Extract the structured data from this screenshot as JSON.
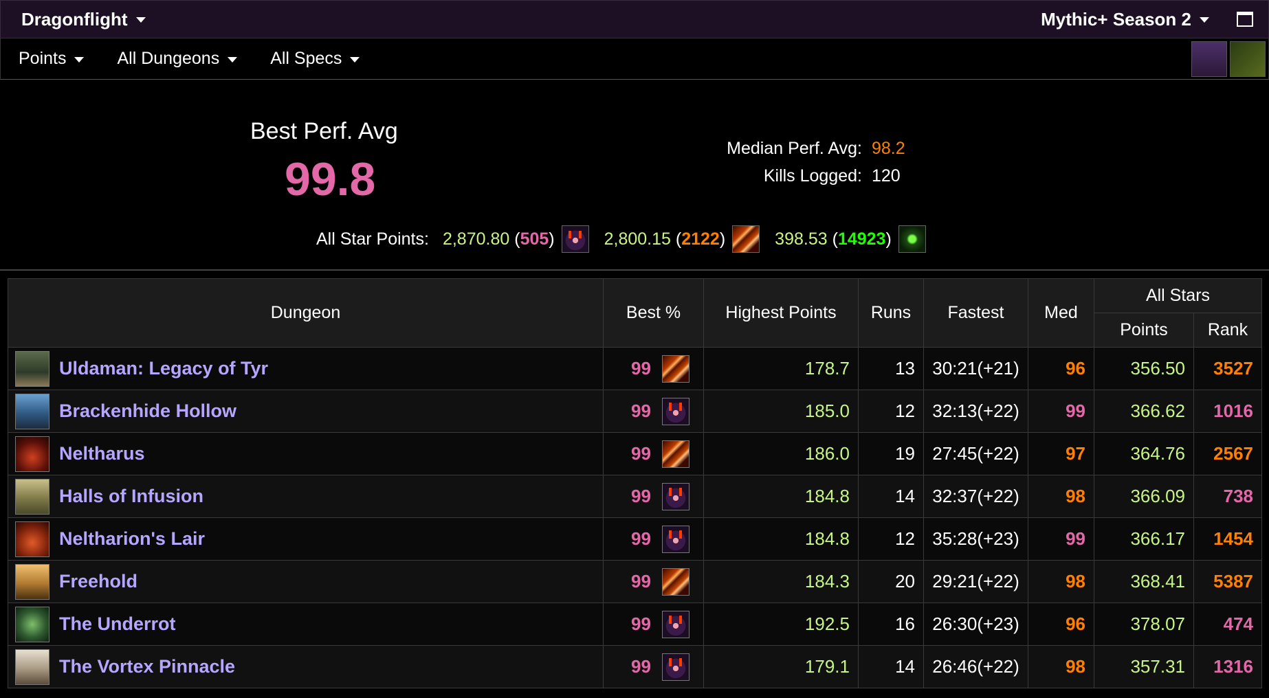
{
  "header": {
    "expansion": "Dragonflight",
    "season": "Mythic+ Season 2"
  },
  "filters": {
    "metric": "Points",
    "dungeons": "All Dungeons",
    "specs": "All Specs"
  },
  "summary": {
    "best_perf_label": "Best Perf. Avg",
    "best_perf_value": "99.8",
    "median_label": "Median Perf. Avg:",
    "median_value": "98.2",
    "kills_label": "Kills Logged:",
    "kills_value": "120",
    "allstar_label": "All Star Points:",
    "allstar": [
      {
        "points": "2,870.80",
        "rank": "505",
        "rank_color": "#e268a8",
        "icon": "demonic-spec-icon"
      },
      {
        "points": "2,800.15",
        "rank": "2122",
        "rank_color": "#ff8000",
        "icon": "fury-spec-icon"
      },
      {
        "points": "398.53",
        "rank": "14923",
        "rank_color": "#1eff00",
        "icon": "green-spec-icon"
      }
    ]
  },
  "table": {
    "headers": {
      "dungeon": "Dungeon",
      "best": "Best %",
      "highest": "Highest Points",
      "runs": "Runs",
      "fastest": "Fastest",
      "med": "Med",
      "allstars": "All Stars",
      "points": "Points",
      "rank": "Rank"
    },
    "rows": [
      {
        "name": "Uldaman: Legacy of Tyr",
        "best": "99",
        "spec": "fury",
        "highest": "178.7",
        "runs": "13",
        "fastest": "30:21(+21)",
        "med": "96",
        "med_color": "orange",
        "points": "356.50",
        "rank": "3527",
        "rank_color": "orange",
        "icon_bg": "linear-gradient(180deg,#5b6a4a,#2e3a28 60%,#8a7a5a)"
      },
      {
        "name": "Brackenhide Hollow",
        "best": "99",
        "spec": "demon",
        "highest": "185.0",
        "runs": "12",
        "fastest": "32:13(+22)",
        "med": "99",
        "med_color": "pink",
        "points": "366.62",
        "rank": "1016",
        "rank_color": "pink",
        "icon_bg": "linear-gradient(180deg,#6aa0d0,#2f5a84 55%,#1d2c3e)"
      },
      {
        "name": "Neltharus",
        "best": "99",
        "spec": "fury",
        "highest": "186.0",
        "runs": "19",
        "fastest": "27:45(+22)",
        "med": "97",
        "med_color": "orange",
        "points": "364.76",
        "rank": "2567",
        "rank_color": "orange",
        "icon_bg": "radial-gradient(circle at 50% 60%,#d04020,#5a1008 60%,#1c0503)"
      },
      {
        "name": "Halls of Infusion",
        "best": "99",
        "spec": "demon",
        "highest": "184.8",
        "runs": "14",
        "fastest": "32:37(+22)",
        "med": "98",
        "med_color": "orange",
        "points": "366.09",
        "rank": "738",
        "rank_color": "pink",
        "icon_bg": "linear-gradient(180deg,#c8c08a,#807a4a 55%,#4a4a2a)"
      },
      {
        "name": "Neltharion's Lair",
        "best": "99",
        "spec": "demon",
        "highest": "184.8",
        "runs": "12",
        "fastest": "35:28(+23)",
        "med": "99",
        "med_color": "pink",
        "points": "366.17",
        "rank": "1454",
        "rank_color": "orange",
        "icon_bg": "radial-gradient(circle at 50% 60%,#e05a28,#7a200a 60%,#2a0a04)"
      },
      {
        "name": "Freehold",
        "best": "99",
        "spec": "fury",
        "highest": "184.3",
        "runs": "20",
        "fastest": "29:21(+22)",
        "med": "98",
        "med_color": "orange",
        "points": "368.41",
        "rank": "5387",
        "rank_color": "orange",
        "icon_bg": "linear-gradient(180deg,#f0c070,#b07a30 55%,#4a3010)"
      },
      {
        "name": "The Underrot",
        "best": "99",
        "spec": "demon",
        "highest": "192.5",
        "runs": "16",
        "fastest": "26:30(+23)",
        "med": "96",
        "med_color": "orange",
        "points": "378.07",
        "rank": "474",
        "rank_color": "pink",
        "icon_bg": "radial-gradient(circle at 50% 50%,#7fbf6a,#2f5a30 55%,#0f2010)"
      },
      {
        "name": "The Vortex Pinnacle",
        "best": "99",
        "spec": "demon",
        "highest": "179.1",
        "runs": "14",
        "fastest": "26:46(+22)",
        "med": "98",
        "med_color": "orange",
        "points": "357.31",
        "rank": "1316",
        "rank_color": "pink",
        "icon_bg": "linear-gradient(180deg,#e8e0d0,#a89a84 55%,#5a4c3a)"
      }
    ]
  }
}
